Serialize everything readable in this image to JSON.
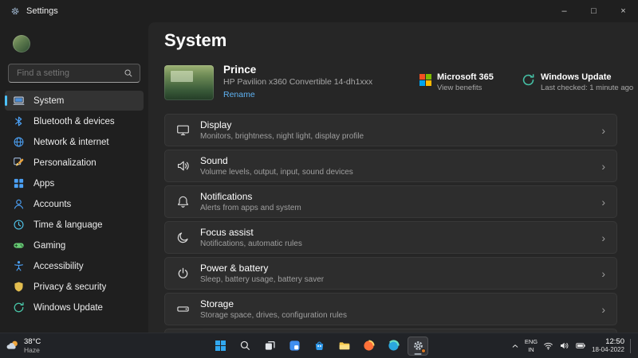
{
  "titlebar": {
    "title": "Settings",
    "minimize_glyph": "–",
    "maximize_glyph": "□",
    "close_glyph": "×"
  },
  "sidebar": {
    "search_placeholder": "Find a setting",
    "items": [
      {
        "label": "System",
        "icon": "system-icon",
        "selected": true
      },
      {
        "label": "Bluetooth & devices",
        "icon": "bluetooth-icon",
        "selected": false
      },
      {
        "label": "Network & internet",
        "icon": "network-icon",
        "selected": false
      },
      {
        "label": "Personalization",
        "icon": "personalization-icon",
        "selected": false
      },
      {
        "label": "Apps",
        "icon": "apps-icon",
        "selected": false
      },
      {
        "label": "Accounts",
        "icon": "accounts-icon",
        "selected": false
      },
      {
        "label": "Time & language",
        "icon": "time-language-icon",
        "selected": false
      },
      {
        "label": "Gaming",
        "icon": "gaming-icon",
        "selected": false
      },
      {
        "label": "Accessibility",
        "icon": "accessibility-icon",
        "selected": false
      },
      {
        "label": "Privacy & security",
        "icon": "privacy-icon",
        "selected": false
      },
      {
        "label": "Windows Update",
        "icon": "windows-update-icon",
        "selected": false
      }
    ]
  },
  "main": {
    "title": "System",
    "device": {
      "name": "Prince",
      "model": "HP Pavilion x360 Convertible 14-dh1xxx",
      "rename_label": "Rename"
    },
    "ms365": {
      "title": "Microsoft 365",
      "subtitle": "View benefits",
      "icon": "microsoft-365-icon"
    },
    "windows_update": {
      "title": "Windows Update",
      "subtitle": "Last checked: 1 minute ago",
      "icon": "windows-update-icon"
    },
    "cards": [
      {
        "title": "Display",
        "subtitle": "Monitors, brightness, night light, display profile",
        "icon": "display-icon"
      },
      {
        "title": "Sound",
        "subtitle": "Volume levels, output, input, sound devices",
        "icon": "sound-icon"
      },
      {
        "title": "Notifications",
        "subtitle": "Alerts from apps and system",
        "icon": "notifications-icon"
      },
      {
        "title": "Focus assist",
        "subtitle": "Notifications, automatic rules",
        "icon": "focus-assist-icon"
      },
      {
        "title": "Power & battery",
        "subtitle": "Sleep, battery usage, battery saver",
        "icon": "power-icon"
      },
      {
        "title": "Storage",
        "subtitle": "Storage space, drives, configuration rules",
        "icon": "storage-icon"
      }
    ]
  },
  "taskbar": {
    "weather": {
      "temp": "38°C",
      "condition": "Haze",
      "icon": "sun-cloud-icon"
    },
    "app_icons": [
      "start-icon",
      "search-icon",
      "task-view-icon",
      "widgets-icon",
      "store-icon",
      "file-explorer-icon",
      "firefox-icon",
      "edge-icon",
      "settings-icon"
    ],
    "active_app": "settings",
    "tray": {
      "language": "ENG",
      "region": "IN",
      "time": "12:50",
      "date": "18-04-2022"
    }
  },
  "icons": {
    "chevron_right": "›"
  },
  "colors": {
    "accent": "#4cc2ff",
    "link": "#5fb2f2",
    "selected_pill": "#4cc2ff"
  }
}
